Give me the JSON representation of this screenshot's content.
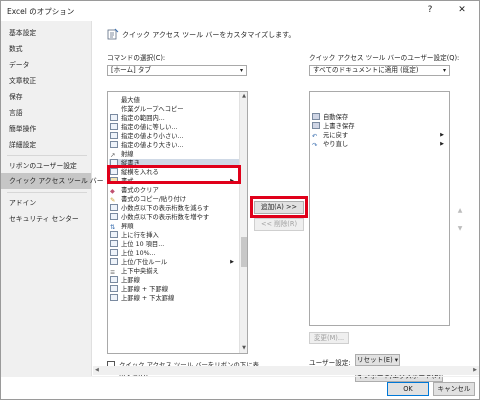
{
  "window": {
    "title": "Excel のオプション",
    "help_label": "?",
    "close_label": "✕"
  },
  "sidebar": {
    "items": [
      {
        "label": "基本設定"
      },
      {
        "label": "数式"
      },
      {
        "label": "データ"
      },
      {
        "label": "文章校正"
      },
      {
        "label": "保存"
      },
      {
        "label": "言語"
      },
      {
        "label": "簡単操作"
      },
      {
        "label": "詳細設定"
      },
      {
        "label": "リボンのユーザー設定"
      },
      {
        "label": "クイック アクセス ツール バー"
      },
      {
        "label": "アドイン"
      },
      {
        "label": "セキュリティ センター"
      }
    ]
  },
  "main": {
    "heading": "クイック アクセス ツール バーをカスタマイズします。",
    "command_label": "コマンドの選択(C):",
    "command_value": "[ホーム] タブ",
    "qat_label": "クイック アクセス ツール バーのユーザー設定(Q):",
    "qat_value": "すべてのドキュメントに適用 (既定)",
    "commands": [
      {
        "label": "最大値"
      },
      {
        "label": "作業グループへコピー"
      },
      {
        "label": "指定の範囲内..."
      },
      {
        "label": "指定の値に等しい..."
      },
      {
        "label": "指定の値より小さい..."
      },
      {
        "label": "指定の値より大きい..."
      },
      {
        "label": "射線"
      },
      {
        "label": "縦書き"
      },
      {
        "label": "縦横を入れる"
      },
      {
        "label": "書式"
      },
      {
        "label": "書式のクリア"
      },
      {
        "label": "書式のコピー/貼り付け"
      },
      {
        "label": "小数点以下の表示桁数を減らす"
      },
      {
        "label": "小数点以下の表示桁数を増やす"
      },
      {
        "label": "昇順"
      },
      {
        "label": "上に行を挿入"
      },
      {
        "label": "上位 10 項目..."
      },
      {
        "label": "上位 10%..."
      },
      {
        "label": "上位/下位ルール"
      },
      {
        "label": "上下中央揃え"
      },
      {
        "label": "上罫線"
      },
      {
        "label": "上罫線 + 下罫線"
      },
      {
        "label": "上罫線 + 下太罫線"
      }
    ],
    "qat_items": [
      {
        "label": "自動保存"
      },
      {
        "label": "上書き保存"
      },
      {
        "label": "元に戻す"
      },
      {
        "label": "やり直し"
      }
    ],
    "add_label": "追加(A) >>",
    "remove_label": "<< 削除(R)",
    "modify_label": "変更(M)...",
    "user_setting_label": "ユーザー設定:",
    "reset_label": "リセット(E) ▾",
    "import_export_label": "インポート/エクスポート(P) ▾",
    "show_below_label_1": "クイック アクセス ツール バーをリボンの下に表",
    "show_below_label_2": "示する(H)"
  },
  "footer": {
    "ok_label": "OK",
    "cancel_label": "キャンセル"
  },
  "colors": {
    "highlight": "#e0001a",
    "selected_row": "#cfd9e6",
    "sidebar_active": "#c6c6c6"
  }
}
